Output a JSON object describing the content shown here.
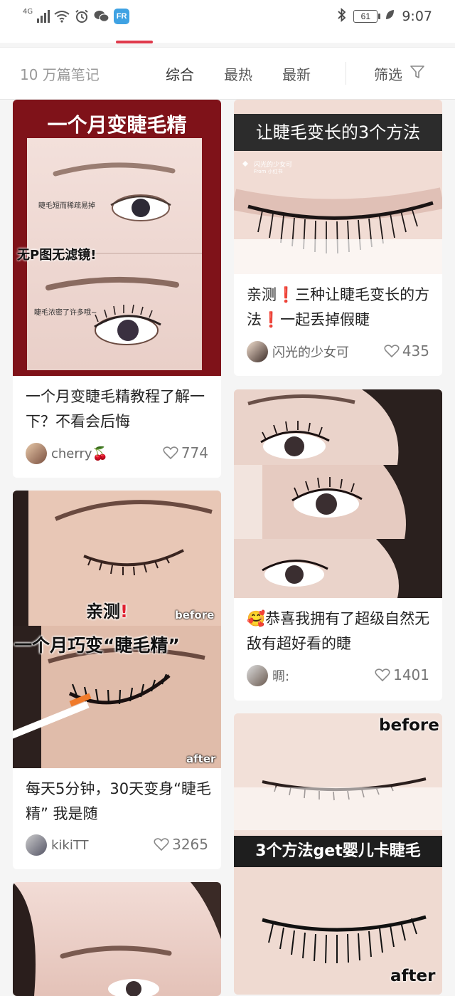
{
  "status": {
    "network": "4G",
    "battery": "61",
    "time": "9:07",
    "app_badge": "FR"
  },
  "filter_bar": {
    "note_count": "10 万篇笔记",
    "sort_tabs": [
      "综合",
      "最热",
      "最新"
    ],
    "filter_label": "筛选"
  },
  "cards": [
    {
      "overlay_top": "一个月变睫毛精",
      "overlay_upper_note": "睫毛短而稀疏易掉",
      "overlay_mid": "无P图无滤镜!",
      "overlay_lower_note": "睫毛浓密了许多哦~",
      "title": "一个月变睫毛精教程了解一下？不看会后悔",
      "author": "cherry🍒",
      "likes": "774"
    },
    {
      "overlay_top": "亲测",
      "overlay_before": "before",
      "overlay_mid": "一个月巧变“睫毛精”",
      "overlay_after": "after",
      "title": "每天5分钟，30天变身“睫毛精” 我是随",
      "author": "kikiTT",
      "likes": "3265"
    },
    {
      "overlay_top": "让睫毛变长的3个方法",
      "overlay_watermark": "闪光的少女可",
      "overlay_watermark_sub": "From 小红书",
      "title": "亲测❗️三种让睫毛变长的方法❗️一起丢掉假睫",
      "author": "闪光的少女可",
      "likes": "435"
    },
    {
      "title": "🥰恭喜我拥有了超级自然无敌有超好看的睫",
      "author": "晭:",
      "likes": "1401"
    },
    {
      "overlay_before": "before",
      "overlay_mid": "3个方法get婴儿卡睫毛",
      "overlay_after": "after"
    }
  ],
  "colors": {
    "accent": "#e03a4c",
    "card1_bg": "#7f1219",
    "background": "#f5f5f5"
  }
}
